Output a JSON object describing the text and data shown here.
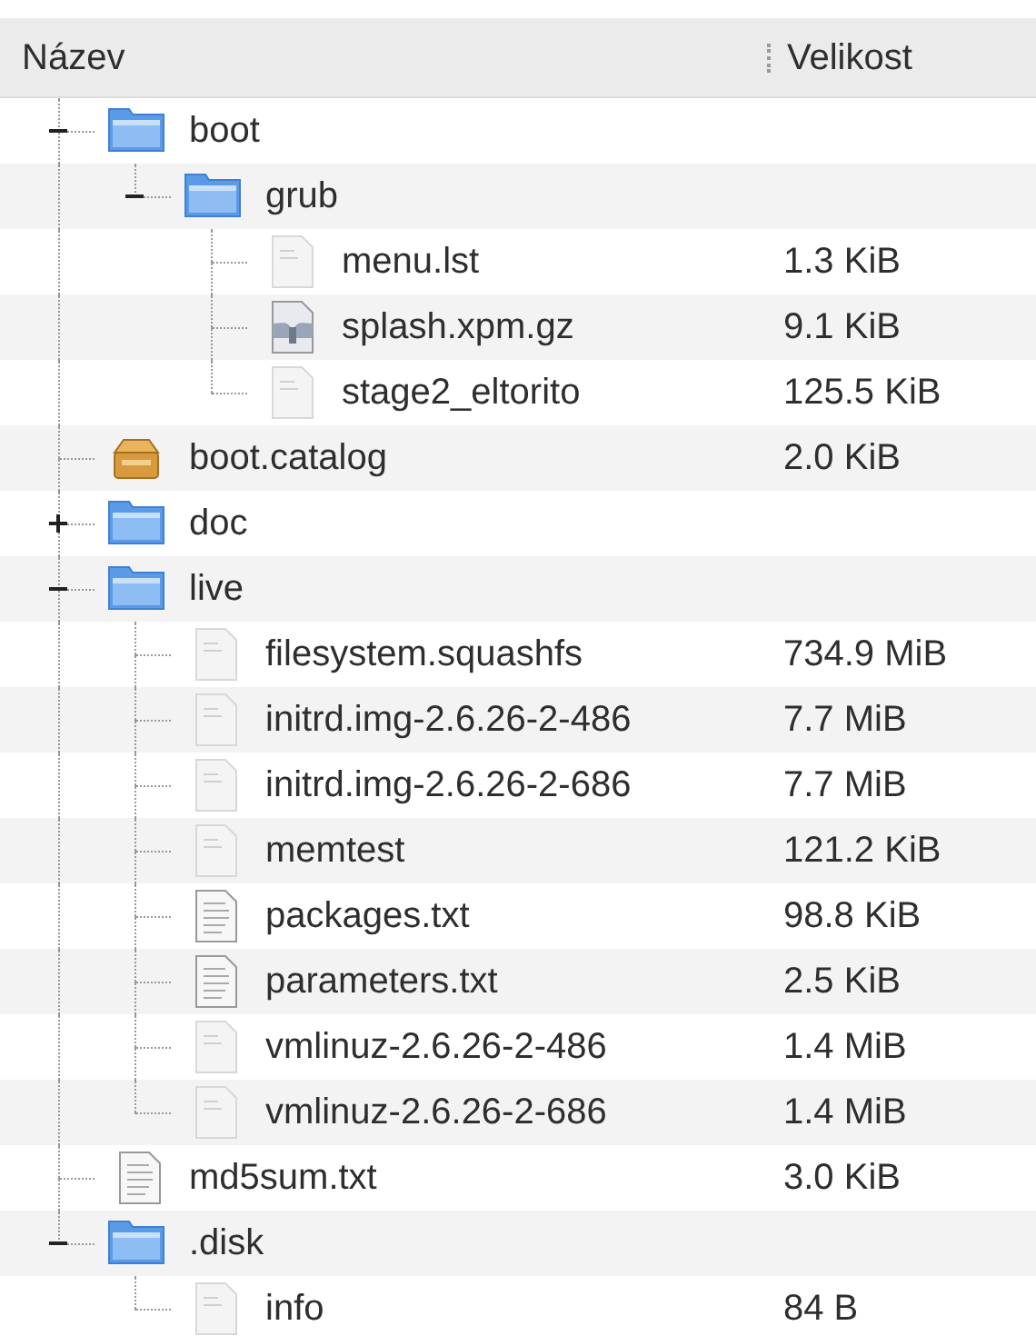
{
  "columns": [
    {
      "label": "Název"
    },
    {
      "label": "Velikost"
    }
  ],
  "items": [
    {
      "name": "boot",
      "kind": "folder",
      "expanded": true,
      "children": [
        {
          "name": "grub",
          "kind": "folder",
          "expanded": true,
          "children": [
            {
              "name": "menu.lst",
              "size": "1.3 KiB",
              "kind": "binary"
            },
            {
              "name": "splash.xpm.gz",
              "size": "9.1 KiB",
              "kind": "image"
            },
            {
              "name": "stage2_eltorito",
              "size": "125.5 KiB",
              "kind": "binary"
            }
          ]
        }
      ]
    },
    {
      "name": "boot.catalog",
      "size": "2.0 KiB",
      "kind": "package"
    },
    {
      "name": "doc",
      "kind": "folder",
      "expanded": false
    },
    {
      "name": "live",
      "kind": "folder",
      "expanded": true,
      "children": [
        {
          "name": "filesystem.squashfs",
          "size": "734.9 MiB",
          "kind": "binary"
        },
        {
          "name": "initrd.img-2.6.26-2-486",
          "size": "7.7 MiB",
          "kind": "binary"
        },
        {
          "name": "initrd.img-2.6.26-2-686",
          "size": "7.7 MiB",
          "kind": "binary"
        },
        {
          "name": "memtest",
          "size": "121.2 KiB",
          "kind": "binary"
        },
        {
          "name": "packages.txt",
          "size": "98.8 KiB",
          "kind": "text"
        },
        {
          "name": "parameters.txt",
          "size": "2.5 KiB",
          "kind": "text"
        },
        {
          "name": "vmlinuz-2.6.26-2-486",
          "size": "1.4 MiB",
          "kind": "binary"
        },
        {
          "name": "vmlinuz-2.6.26-2-686",
          "size": "1.4 MiB",
          "kind": "binary"
        }
      ]
    },
    {
      "name": "md5sum.txt",
      "size": "3.0 KiB",
      "kind": "text"
    },
    {
      "name": ".disk",
      "kind": "folder",
      "expanded": true,
      "children": [
        {
          "name": "info",
          "size": "84 B",
          "kind": "binary"
        }
      ]
    }
  ]
}
